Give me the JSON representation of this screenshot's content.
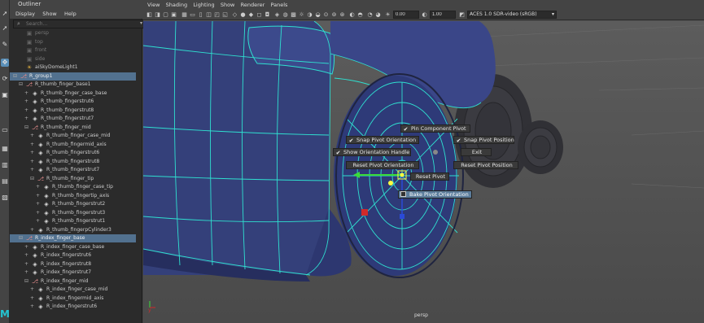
{
  "outliner": {
    "title": "Outliner",
    "menu": [
      "Display",
      "Show",
      "Help"
    ],
    "search_placeholder": "Search...",
    "rows": [
      {
        "label": "persp",
        "icon": "camera-icon",
        "dim": true
      },
      {
        "label": "top",
        "icon": "camera-icon",
        "dim": true
      },
      {
        "label": "front",
        "icon": "camera-icon",
        "dim": true
      },
      {
        "label": "side",
        "icon": "camera-icon",
        "dim": true
      },
      {
        "label": "aiSkyDomeLight1",
        "icon": "light-icon"
      },
      {
        "label": "R_group1",
        "icon": "group-icon",
        "selected": true
      },
      {
        "label": "R_thumb_finger_base1",
        "icon": "group-icon"
      },
      {
        "label": "R_thumb_finger_case_base",
        "icon": "mesh-icon"
      },
      {
        "label": "R_thumb_fingerstrut6",
        "icon": "mesh-icon"
      },
      {
        "label": "R_thumb_fingerstrut8",
        "icon": "mesh-icon"
      },
      {
        "label": "R_thumb_fingerstrut7",
        "icon": "mesh-icon"
      },
      {
        "label": "R_thumb_finger_mid",
        "icon": "group-icon"
      },
      {
        "label": "R_thumb_finger_case_mid",
        "icon": "mesh-icon"
      },
      {
        "label": "R_thumb_fingermid_axis",
        "icon": "mesh-icon"
      },
      {
        "label": "R_thumb_fingerstrut6",
        "icon": "mesh-icon"
      },
      {
        "label": "R_thumb_fingerstrut8",
        "icon": "mesh-icon"
      },
      {
        "label": "R_thumb_fingerstrut7",
        "icon": "mesh-icon"
      },
      {
        "label": "R_thumb_finger_tip",
        "icon": "group-icon"
      },
      {
        "label": "R_thumb_finger_case_tip",
        "icon": "mesh-icon"
      },
      {
        "label": "R_thumb_fingertip_axis",
        "icon": "mesh-icon"
      },
      {
        "label": "R_thumb_fingerstrut2",
        "icon": "mesh-icon"
      },
      {
        "label": "R_thumb_fingerstrut3",
        "icon": "mesh-icon"
      },
      {
        "label": "R_thumb_fingerstrut1",
        "icon": "mesh-icon"
      },
      {
        "label": "R_thumb_fingerpCylinder3",
        "icon": "mesh-icon"
      },
      {
        "label": "R_index_finger_base",
        "icon": "group-icon",
        "selected": true
      },
      {
        "label": "R_index_finger_case_base",
        "icon": "mesh-icon"
      },
      {
        "label": "R_index_fingerstrut6",
        "icon": "mesh-icon"
      },
      {
        "label": "R_index_fingerstrut8",
        "icon": "mesh-icon"
      },
      {
        "label": "R_index_fingerstrut7",
        "icon": "mesh-icon"
      },
      {
        "label": "R_index_finger_mid",
        "icon": "group-icon"
      },
      {
        "label": "R_index_finger_case_mid",
        "icon": "mesh-icon"
      },
      {
        "label": "R_index_fingermid_axis",
        "icon": "mesh-icon"
      },
      {
        "label": "R_index_fingerstrut6",
        "icon": "mesh-icon"
      }
    ]
  },
  "viewport": {
    "menu": [
      "View",
      "Shading",
      "Lighting",
      "Show",
      "Renderer",
      "Panels"
    ],
    "exposure": "0.00",
    "gamma": "1.00",
    "color_space": "ACES 1.0 SDR-video (sRGB)",
    "camera_label": "persp"
  },
  "marking_menu": {
    "pin_component_pivot": "Pin Component Pivot",
    "snap_pivot_orientation": "Snap Pivot Orientation",
    "snap_pivot_position": "Snap Pivot Position",
    "show_orientation_handle": "Show Orientation Handle",
    "exit": "Exit",
    "reset_pivot_orientation": "Reset Pivot Orientation",
    "reset_pivot_position": "Reset Pivot Position",
    "reset_pivot": "Reset Pivot",
    "bake_pivot_orientation": "Bake Pivot Orientation"
  },
  "colors": {
    "mesh": "#34407a",
    "wireframe": "#2fe0d0",
    "highlight": "#5c7d9c",
    "selection_row": "#52718f"
  }
}
